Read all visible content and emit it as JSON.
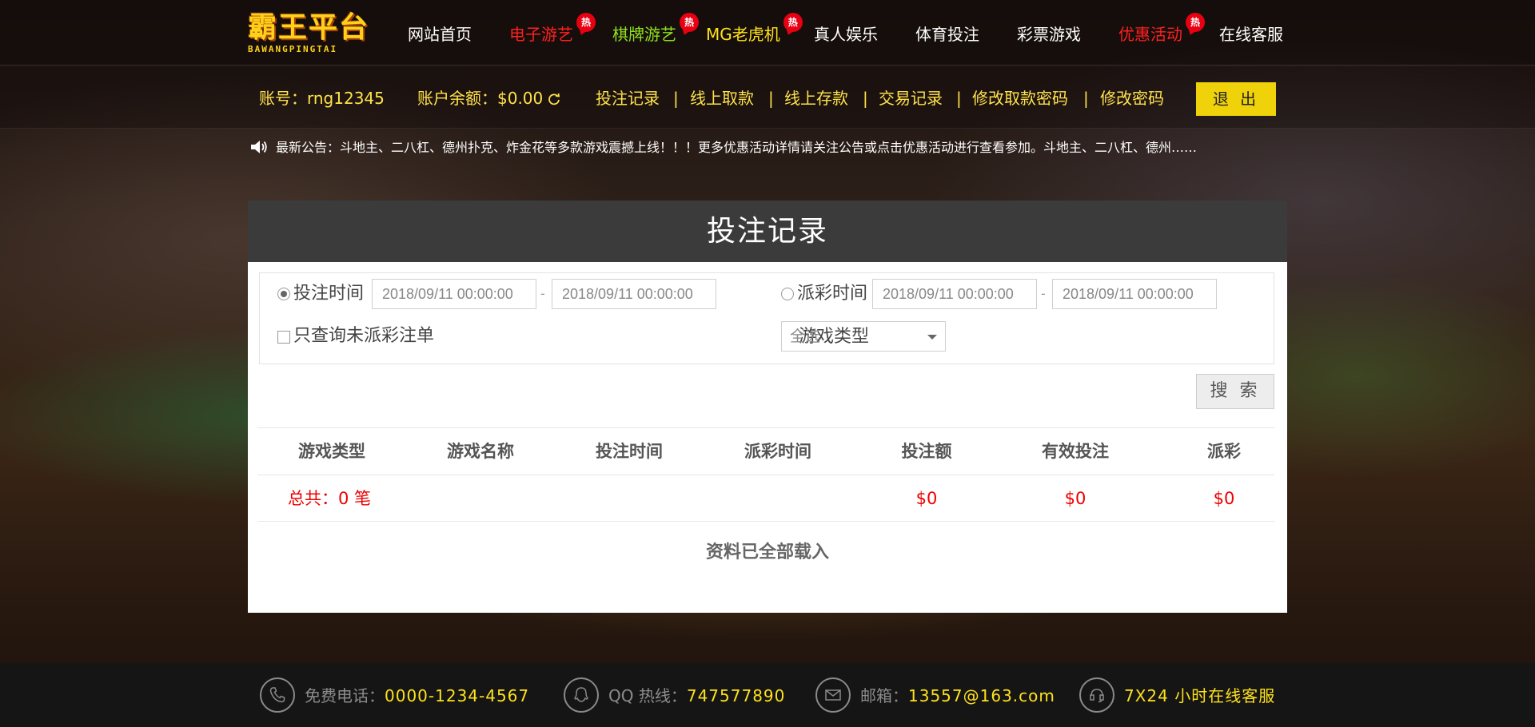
{
  "logo": {
    "title": "霸王平台",
    "subtitle": "BAWANGPINGTAI"
  },
  "nav": {
    "items": [
      {
        "label": "网站首页"
      },
      {
        "label": "电子游艺",
        "badge": "热"
      },
      {
        "label": "棋牌游艺",
        "badge": "热"
      },
      {
        "label": "MG老虎机",
        "badge": "热"
      },
      {
        "label": "真人娱乐"
      },
      {
        "label": "体育投注"
      },
      {
        "label": "彩票游戏"
      },
      {
        "label": "优惠活动",
        "badge": "热"
      },
      {
        "label": "在线客服"
      }
    ]
  },
  "account": {
    "account_label": "账号：rng12345",
    "balance_label": "账户余额：$0.00",
    "links": [
      "投注记录",
      "线上取款",
      "线上存款",
      "交易记录",
      "修改取款密码",
      "修改密码"
    ],
    "separator": "|",
    "logout": "退 出"
  },
  "notice": {
    "text": "最新公告：斗地主、二八杠、德州扑克、炸金花等多款游戏震撼上线！！！更多优惠活动详情请关注公告或点击优惠活动进行查看参加。斗地主、二八杠、德州……"
  },
  "panel": {
    "title": "投注记录",
    "filters": {
      "bet_time_label": "投注时间",
      "bet_start": "2018/09/11 00:00:00",
      "bet_end": "2018/09/11 00:00:00",
      "payout_time_label": "派彩时间",
      "payout_start": "2018/09/11 00:00:00",
      "payout_end": "2018/09/11 00:00:00",
      "dash": "-",
      "unpaid_only_label": "只查询未派彩注单",
      "game_type_label": "游戏类型",
      "game_type_value": "全选",
      "selected_time_mode": "投注时间",
      "unpaid_only_checked": false
    },
    "search": "搜 索",
    "table": {
      "headers": [
        "游戏类型",
        "游戏名称",
        "投注时间",
        "派彩时间",
        "投注额",
        "有效投注",
        "派彩"
      ],
      "total_label": "总共：0 笔",
      "totals": {
        "bet": "$0",
        "valid": "$0",
        "payout": "$0"
      }
    },
    "loaded_text": "资料已全部载入"
  },
  "footer": {
    "phone_label": "免费电话：",
    "phone": "0000-1234-4567",
    "qq_label": "QQ 热线：",
    "qq": "747577890",
    "email_label": "邮箱：",
    "email": "13557@163.com",
    "service": "7X24 小时在线客服"
  },
  "colors": {
    "accent_yellow": "#ffe21a",
    "hot_red": "#e60012",
    "nav_red": "#ff2020",
    "nav_green": "#8fe01e",
    "panel_header": "#3b3b3b",
    "logout_bg": "#f0d20a"
  }
}
